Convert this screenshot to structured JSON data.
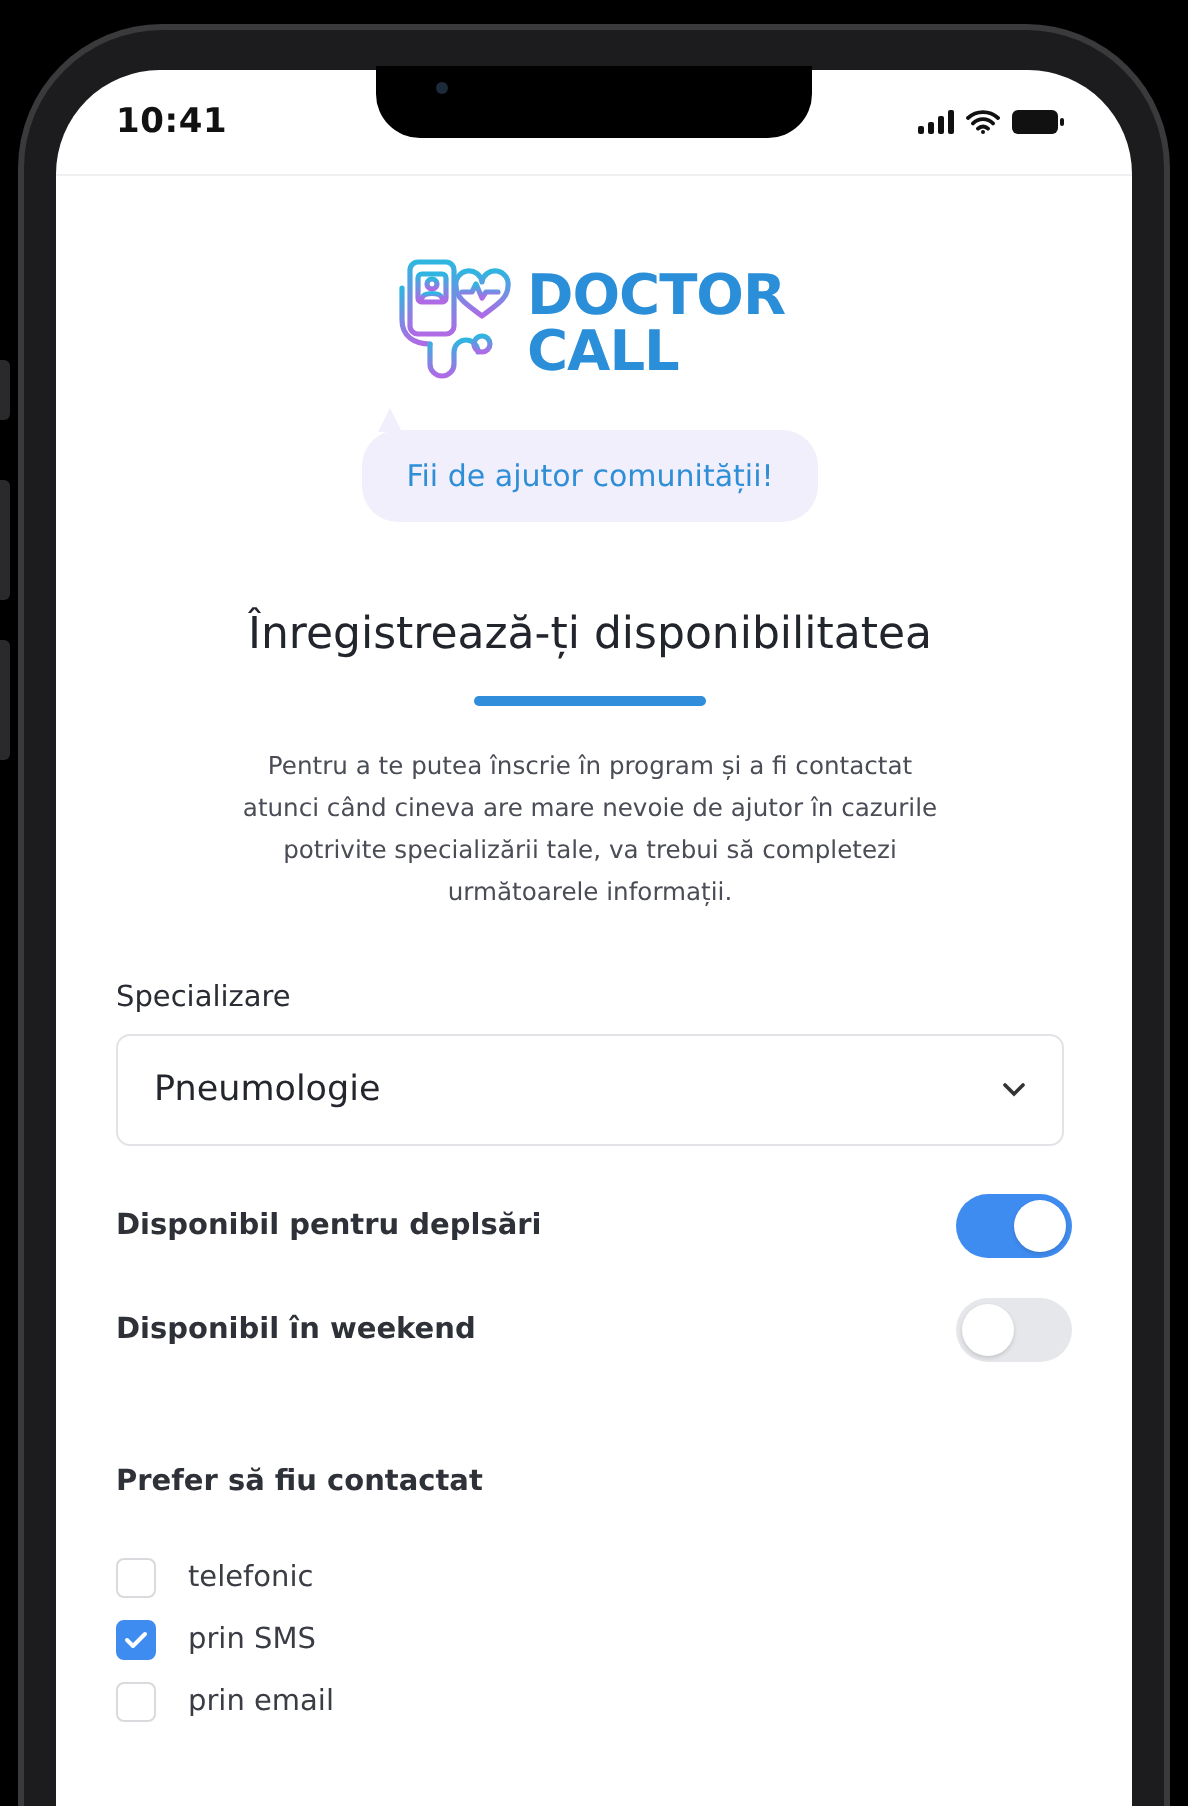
{
  "status_bar": {
    "time": "10:41"
  },
  "logo": {
    "line_1": "DOCTOR",
    "line_2": "CALL"
  },
  "tagline": "Fii de ajutor comunității!",
  "title": "Înregistrează-ți disponibilitatea",
  "intro": "Pentru a te putea înscrie în program și a fi contactat atunci când cineva are mare nevoie de ajutor în cazurile potrivite specializării tale, va trebui să completezi următoarele informații.",
  "specialization": {
    "label": "Specializare",
    "value": "Pneumologie"
  },
  "toggles": [
    {
      "label": "Disponibil pentru deplsări",
      "on": true
    },
    {
      "label": "Disponibil în weekend",
      "on": false
    }
  ],
  "contact": {
    "label": "Prefer să fiu contactat",
    "options": [
      {
        "label": "telefonic",
        "checked": false
      },
      {
        "label": "prin SMS",
        "checked": true
      },
      {
        "label": "prin email",
        "checked": false
      }
    ]
  }
}
